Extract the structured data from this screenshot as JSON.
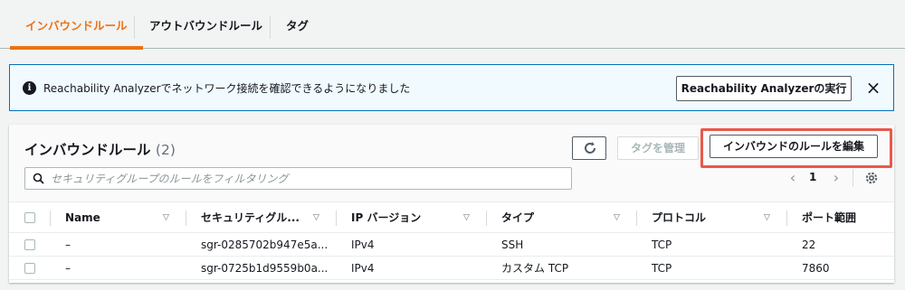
{
  "tabs": [
    {
      "label": "インバウンドルール",
      "active": true
    },
    {
      "label": "アウトバウンドルール",
      "active": false
    },
    {
      "label": "タグ",
      "active": false
    }
  ],
  "flash": {
    "icon": "info-icon",
    "message": "Reachability Analyzerでネットワーク接続を確認できるようになりました",
    "button_label": "Reachability Analyzerの実行",
    "close": "×"
  },
  "panel": {
    "title": "インバウンドルール",
    "count": "(2)",
    "refresh_icon": "refresh-icon",
    "manage_tags_label": "タグを管理",
    "edit_rules_label": "インバウンドのルールを編集"
  },
  "search": {
    "placeholder": "セキュリティグループのルールをフィルタリング",
    "value": ""
  },
  "pagination": {
    "prev": "‹",
    "page": "1",
    "next": "›"
  },
  "table": {
    "columns": [
      "Name",
      "セキュリティグル...",
      "IP バージョン",
      "タイプ",
      "プロトコル",
      "ポート範囲"
    ],
    "rows": [
      [
        "–",
        "sgr-0285702b947e5a...",
        "IPv4",
        "SSH",
        "TCP",
        "22"
      ],
      [
        "–",
        "sgr-0725b1d9559b0a...",
        "IPv4",
        "カスタム TCP",
        "TCP",
        "7860"
      ]
    ]
  },
  "colors": {
    "accent": "#ec7211",
    "info_border": "#0073bb",
    "info_bg": "#f1faff",
    "highlight": "#e8594a"
  }
}
